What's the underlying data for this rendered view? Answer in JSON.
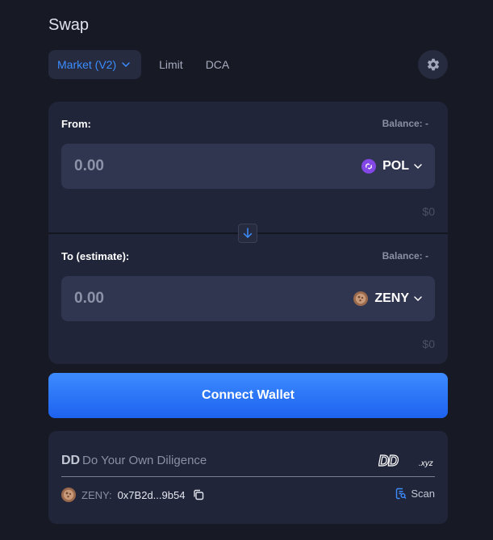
{
  "header": {
    "title": "Swap"
  },
  "tabs": {
    "market_label": "Market (V2)",
    "limit_label": "Limit",
    "dca_label": "DCA"
  },
  "from": {
    "label": "From:",
    "balance": "Balance: -",
    "amount": "0.00",
    "token": "POL",
    "usd": "$0"
  },
  "to": {
    "label": "To (estimate):",
    "balance": "Balance: -",
    "amount": "0.00",
    "token": "ZENY",
    "usd": "$0"
  },
  "connect_wallet_label": "Connect Wallet",
  "dd": {
    "brand": "DD",
    "tagline": "Do Your Own Diligence",
    "logo_text": "DD.xyz",
    "token_name": "ZENY:",
    "address": "0x7B2d...9b54",
    "scan_label": "Scan"
  },
  "colors": {
    "accent": "#3c8dff",
    "background": "#171a25",
    "card": "#212539",
    "pol_brand": "#8247e5"
  },
  "icons": {
    "settings": "gear-icon",
    "flip": "arrow-down-icon",
    "copy": "copy-icon",
    "scan": "scan-icon"
  }
}
